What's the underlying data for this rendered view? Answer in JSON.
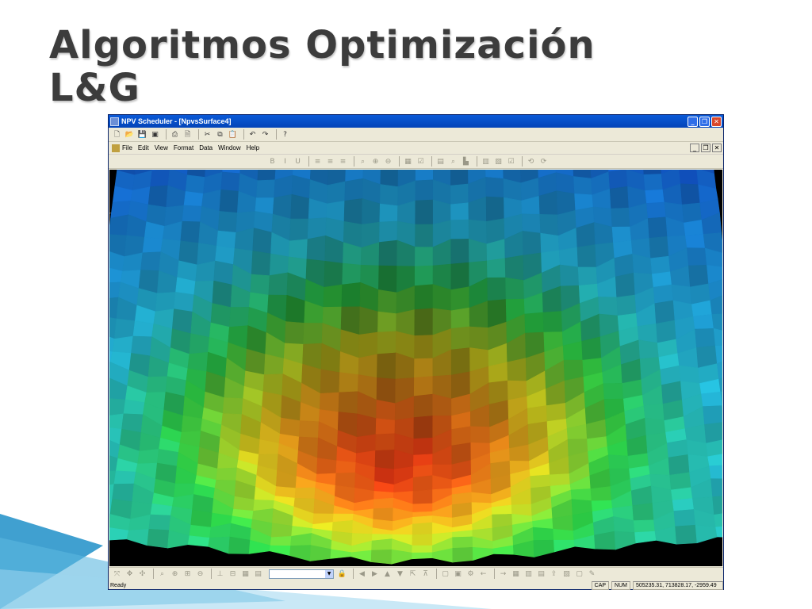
{
  "slide": {
    "title_line1": "Algoritmos Optimización",
    "title_line2": "L&G"
  },
  "window": {
    "title": "NPV Scheduler - [NpvsSurface4]",
    "controls": {
      "minimize": "_",
      "restore": "❐",
      "close": "✕"
    }
  },
  "toolbar": {
    "buttons": [
      {
        "name": "new-icon",
        "glyph": "🗋"
      },
      {
        "name": "open-icon",
        "glyph": "📂"
      },
      {
        "name": "save-icon",
        "glyph": "💾"
      },
      {
        "name": "save-all-icon",
        "glyph": "▣"
      },
      {
        "name": "print-icon",
        "glyph": "⎙"
      },
      {
        "name": "print-preview-icon",
        "glyph": "🗎"
      },
      {
        "name": "cut-icon",
        "glyph": "✂"
      },
      {
        "name": "copy-icon",
        "glyph": "⧉"
      },
      {
        "name": "paste-icon",
        "glyph": "📋"
      },
      {
        "name": "undo-icon",
        "glyph": "↶"
      },
      {
        "name": "redo-icon",
        "glyph": "↷"
      },
      {
        "name": "context-help-icon",
        "glyph": "?"
      }
    ]
  },
  "menu": {
    "items": [
      "File",
      "Edit",
      "View",
      "Format",
      "Data",
      "Window",
      "Help"
    ],
    "mdi": {
      "minimize": "_",
      "restore": "❐",
      "close": "✕"
    }
  },
  "format_toolbar": {
    "buttons": [
      {
        "name": "bold-icon",
        "glyph": "B"
      },
      {
        "name": "italic-icon",
        "glyph": "I"
      },
      {
        "name": "underline-icon",
        "glyph": "U"
      },
      {
        "name": "align-left-icon",
        "glyph": "≡"
      },
      {
        "name": "align-center-icon",
        "glyph": "≡"
      },
      {
        "name": "align-right-icon",
        "glyph": "≡"
      },
      {
        "name": "zoom-icon",
        "glyph": "⌕"
      },
      {
        "name": "zoom-in-icon",
        "glyph": "⊕"
      },
      {
        "name": "zoom-out-icon",
        "glyph": "⊖"
      },
      {
        "name": "chart-icon",
        "glyph": "▦"
      },
      {
        "name": "check-icon",
        "glyph": "☑"
      },
      {
        "name": "graph-icon",
        "glyph": "▤"
      },
      {
        "name": "search-icon",
        "glyph": "⌕"
      },
      {
        "name": "histogram-icon",
        "glyph": "▙"
      },
      {
        "name": "bar-chart-icon",
        "glyph": "▥"
      },
      {
        "name": "stats-icon",
        "glyph": "▧"
      },
      {
        "name": "checkbox-icon",
        "glyph": "☑"
      },
      {
        "name": "link-icon",
        "glyph": "⟲"
      },
      {
        "name": "unlink-icon",
        "glyph": "⟳"
      }
    ]
  },
  "bottom_toolbar": {
    "left_buttons": [
      {
        "name": "rotate-icon",
        "glyph": "⤧"
      },
      {
        "name": "pan-icon",
        "glyph": "✥"
      },
      {
        "name": "move-icon",
        "glyph": "✣"
      },
      {
        "name": "zoom-view-icon",
        "glyph": "⌕"
      },
      {
        "name": "zoom-in-view-icon",
        "glyph": "⊕"
      },
      {
        "name": "zoom-window-icon",
        "glyph": "⊞"
      },
      {
        "name": "zoom-out-view-icon",
        "glyph": "⊖"
      },
      {
        "name": "section-icon",
        "glyph": "⊥"
      },
      {
        "name": "plan-view-icon",
        "glyph": "⊟"
      },
      {
        "name": "grid-icon",
        "glyph": "▦"
      },
      {
        "name": "layer-icon",
        "glyph": "▤"
      }
    ],
    "combo_value": "",
    "combo_arrow": "▼",
    "right_buttons": [
      {
        "name": "lock-icon",
        "glyph": "🔒"
      },
      {
        "name": "prev-icon",
        "glyph": "◀"
      },
      {
        "name": "next-icon",
        "glyph": "▶"
      },
      {
        "name": "up-icon",
        "glyph": "▲"
      },
      {
        "name": "down-icon",
        "glyph": "▼"
      },
      {
        "name": "pointer-icon",
        "glyph": "⇱"
      },
      {
        "name": "marker-icon",
        "glyph": "⊼"
      },
      {
        "name": "view-box-icon",
        "glyph": "▢"
      },
      {
        "name": "properties-icon",
        "glyph": "▣"
      },
      {
        "name": "settings-icon",
        "glyph": "⚙"
      },
      {
        "name": "back-icon",
        "glyph": "←"
      },
      {
        "name": "forward-icon",
        "glyph": "→"
      },
      {
        "name": "table-icon",
        "glyph": "▦"
      },
      {
        "name": "sheet-icon",
        "glyph": "▥"
      },
      {
        "name": "report-icon",
        "glyph": "▤"
      },
      {
        "name": "export-icon",
        "glyph": "⇪"
      },
      {
        "name": "data-icon",
        "glyph": "▧"
      },
      {
        "name": "window-icon",
        "glyph": "▢"
      },
      {
        "name": "note-icon",
        "glyph": "✎"
      }
    ]
  },
  "status": {
    "ready": "Ready",
    "cap": "CAP",
    "num": "NUM",
    "coordinates": "505235.31, 713828.17, -2959.49"
  },
  "colors": {
    "surface_deep": "#0a20d8",
    "surface_blue": "#1a8ae8",
    "surface_cyan": "#28c8e8",
    "surface_green": "#2ed84a",
    "surface_yellow": "#d8d820",
    "surface_orange": "#f07818",
    "surface_red": "#e01010"
  }
}
